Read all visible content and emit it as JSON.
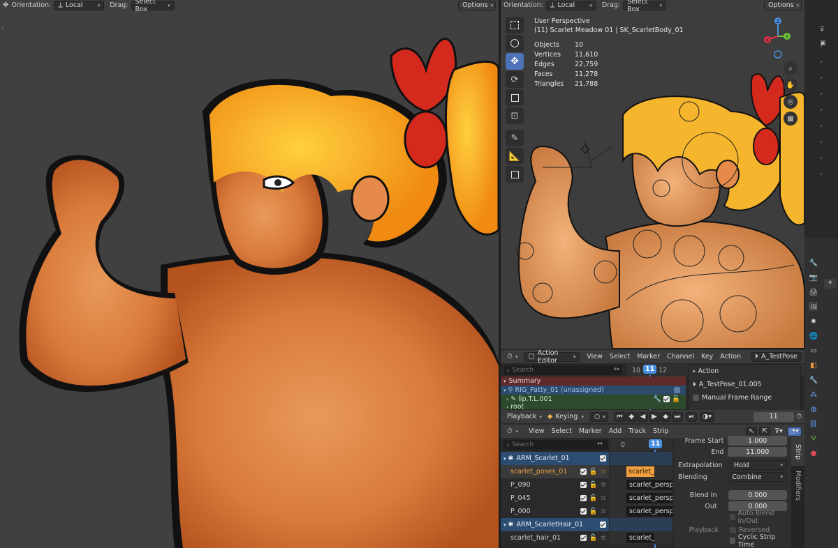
{
  "left_viewport": {
    "orientation_label": "Orientation:",
    "orientation_value": "Local",
    "drag_label": "Drag:",
    "drag_value": "Select Box",
    "options_label": "Options"
  },
  "right_viewport": {
    "orientation_label": "Orientation:",
    "orientation_value": "Local",
    "drag_label": "Drag:",
    "drag_value": "Select Box",
    "options_label": "Options",
    "view_name": "User Perspective",
    "object_info": "(11) Scarlet Meadow 01 | SK_ScarletBody_01",
    "stats": [
      {
        "label": "Objects",
        "value": "10"
      },
      {
        "label": "Vertices",
        "value": "11,610"
      },
      {
        "label": "Edges",
        "value": "22,759"
      },
      {
        "label": "Faces",
        "value": "11,278"
      },
      {
        "label": "Triangles",
        "value": "21,788"
      }
    ],
    "gizmo": {
      "x": "X",
      "y": "Y",
      "z": "Z"
    },
    "tools": [
      "select-box-icon",
      "cursor-icon",
      "move-icon",
      "rotate-icon",
      "scale-icon",
      "transform-icon",
      "annotate-icon",
      "measure-icon",
      "add-cube-icon"
    ]
  },
  "action_editor": {
    "mode": "Action Editor",
    "menu": [
      "View",
      "Select",
      "Marker",
      "Channel",
      "Key",
      "Action"
    ],
    "action_name": "A_TestPose",
    "search_placeholder": "Search",
    "frames": [
      "10",
      "11",
      "12"
    ],
    "channels": [
      {
        "label": "Summary"
      },
      {
        "label": "RIG_Patty_01 (unassigned)"
      },
      {
        "label": "lip.T.L.001"
      },
      {
        "label": "root"
      }
    ],
    "panel_title": "Action",
    "panel_action": "A_TestPose_01.005",
    "manual_frame_range": "Manual Frame Range",
    "playback_label": "Playback",
    "keying_label": "Keying",
    "current_frame": "11"
  },
  "nla_editor": {
    "menu": [
      "View",
      "Select",
      "Marker",
      "Add",
      "Track",
      "Strip"
    ],
    "search_placeholder": "Search",
    "frames": [
      "0",
      "11"
    ],
    "tracks": [
      {
        "name": "ARM_Scarlet_01",
        "type": "armature",
        "strip": ""
      },
      {
        "name": "scarlet_poses_01",
        "type": "track",
        "strip": "scarlet_"
      },
      {
        "name": "P_090",
        "type": "track",
        "strip": "scarlet_perspe"
      },
      {
        "name": "P_045",
        "type": "track",
        "strip": "scarlet_perspe"
      },
      {
        "name": "P_000",
        "type": "track",
        "strip": "scarlet_perspe"
      },
      {
        "name": "ARM_ScarletHair_01",
        "type": "armature",
        "strip": ""
      },
      {
        "name": "scarlet_hair_01",
        "type": "track",
        "strip": "scarlet_"
      }
    ],
    "strip_props": {
      "frame_start_label": "Frame Start",
      "frame_start_value": "1.000",
      "end_label": "End",
      "end_value": "11.000",
      "extrapolation_label": "Extrapolation",
      "extrapolation_value": "Hold",
      "blending_label": "Blending",
      "blending_value": "Combine",
      "blend_in_label": "Blend In",
      "blend_in_value": "0.000",
      "out_label": "Out",
      "out_value": "0.000",
      "auto_blend_label": "Auto Blend In/Out",
      "playback_label": "Playback",
      "reversed_label": "Reversed",
      "cyclic_label": "Cyclic Strip Time"
    },
    "side_tabs": [
      "Strip",
      "Modifiers"
    ]
  },
  "colors": {
    "accent_blue": "#4d72b8",
    "playhead": "#4a90e2",
    "strip_active": "#f0a040",
    "skin": "#d9783a",
    "hair": "#f2b01e",
    "bow": "#d42a1e"
  }
}
